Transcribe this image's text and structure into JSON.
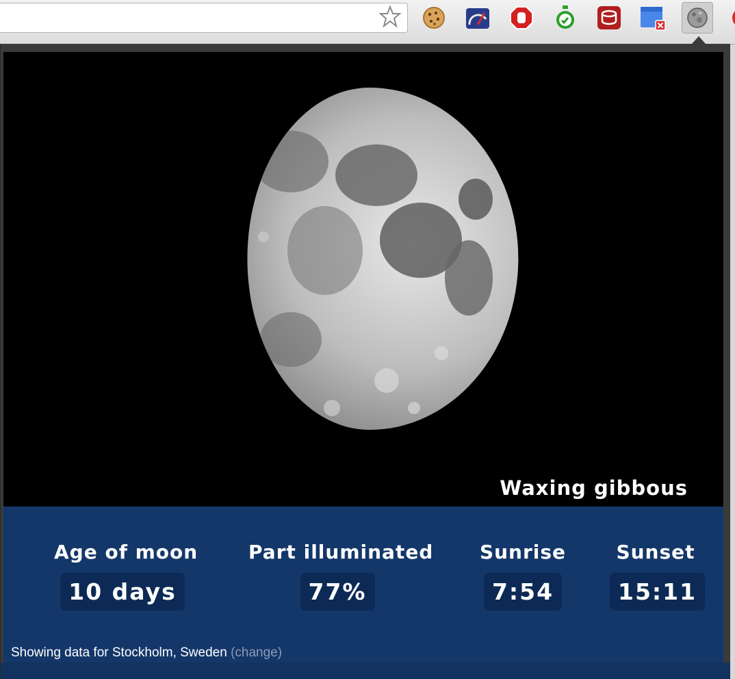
{
  "browser": {
    "extensions": [
      {
        "name": "cookie-extension-icon"
      },
      {
        "name": "speed-dial-extension-icon"
      },
      {
        "name": "adblock-extension-icon"
      },
      {
        "name": "stopwatch-extension-icon"
      },
      {
        "name": "database-extension-icon"
      },
      {
        "name": "calendar-extension-icon"
      },
      {
        "name": "moon-extension-icon"
      }
    ]
  },
  "moon": {
    "phase": "Waxing gibbous",
    "stats": [
      {
        "label": "Age of moon",
        "value": "10 days"
      },
      {
        "label": "Part illuminated",
        "value": "77%"
      },
      {
        "label": "Sunrise",
        "value": "7:54"
      },
      {
        "label": "Sunset",
        "value": "15:11"
      }
    ]
  },
  "location": {
    "prefix": "Showing data for Stockholm, Sweden",
    "change_link": "(change)"
  },
  "colors": {
    "panel": "#14376a",
    "value_box": "#0c2a55",
    "change_link": "#8c9bb6"
  }
}
